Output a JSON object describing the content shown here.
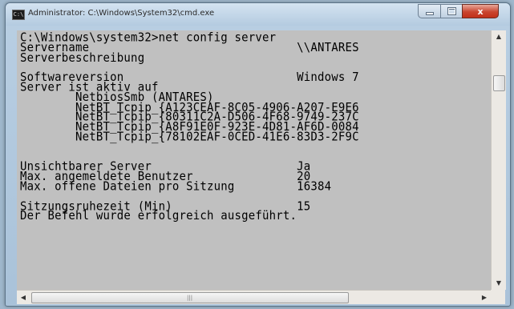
{
  "window": {
    "title": "Administrator: C:\\Windows\\System32\\cmd.exe",
    "app_icon_glyph": "C:\\",
    "controls": {
      "minimize": "",
      "maximize": "",
      "close": "x"
    }
  },
  "console": {
    "lines": [
      "C:\\Windows\\system32>net config server",
      "Servername                              \\\\ANTARES",
      "Serverbeschreibung",
      "",
      "Softwareversion                         Windows 7",
      "Server ist aktiv auf",
      "        NetbiosSmb (ANTARES)",
      "        NetBT_Tcpip_{A123CEAF-8C05-4906-A207-E9E6",
      "        NetBT_Tcpip_{80311C2A-D506-4F68-9749-237C",
      "        NetBT_Tcpip_{A8F91E0F-923E-4D81-AF6D-0084",
      "        NetBT_Tcpip_{78102EAF-0CED-41E6-83D3-2F9C",
      "",
      "",
      "Unsichtbarer Server                     Ja",
      "Max. angemeldete Benutzer               20",
      "Max. offene Dateien pro Sitzung         16384",
      "",
      "Sitzungsruhezeit (Min)                  15",
      "Der Befehl wurde erfolgreich ausgeführt."
    ]
  },
  "scrollbars": {
    "vertical": {
      "up_arrow": "▲",
      "down_arrow": "▼"
    },
    "horizontal": {
      "left_arrow": "◀",
      "right_arrow": "▶",
      "grip": "|||"
    }
  },
  "colors": {
    "console_bg": "#c0c0c0",
    "console_fg": "#000000",
    "close_button": "#c9452f"
  }
}
